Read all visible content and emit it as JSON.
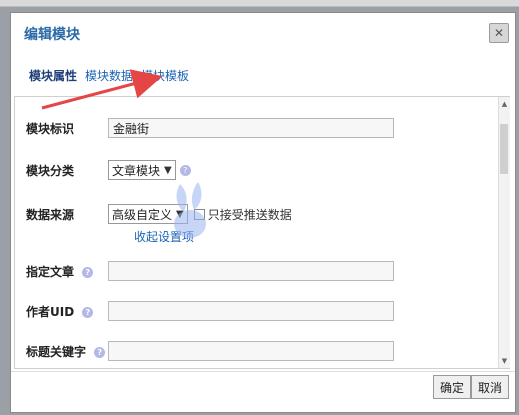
{
  "dialog": {
    "title": "编辑模块",
    "close_symbol": "✕"
  },
  "tabs": [
    {
      "label": "模块属性",
      "active": true
    },
    {
      "label": "模块数据",
      "active": false
    },
    {
      "label": "模块模板",
      "active": false
    }
  ],
  "form": {
    "identifier": {
      "label": "模块标识",
      "value": "金融街"
    },
    "category": {
      "label": "模块分类",
      "selected": "文章模块"
    },
    "source": {
      "label": "数据来源",
      "selected": "高级自定义",
      "checkbox_label": "只接受推送数据",
      "collapse_link": "收起设置项"
    },
    "article": {
      "label": "指定文章",
      "value": ""
    },
    "author_uid": {
      "label": "作者UID",
      "value": ""
    },
    "title_keywords": {
      "label": "标题关键字",
      "value": ""
    }
  },
  "help_symbol": "?",
  "buttons": {
    "ok": "确定",
    "cancel": "取消"
  },
  "colors": {
    "title": "#2a6aa8",
    "link": "#1c63b5",
    "annotation_arrow": "#e64545"
  }
}
